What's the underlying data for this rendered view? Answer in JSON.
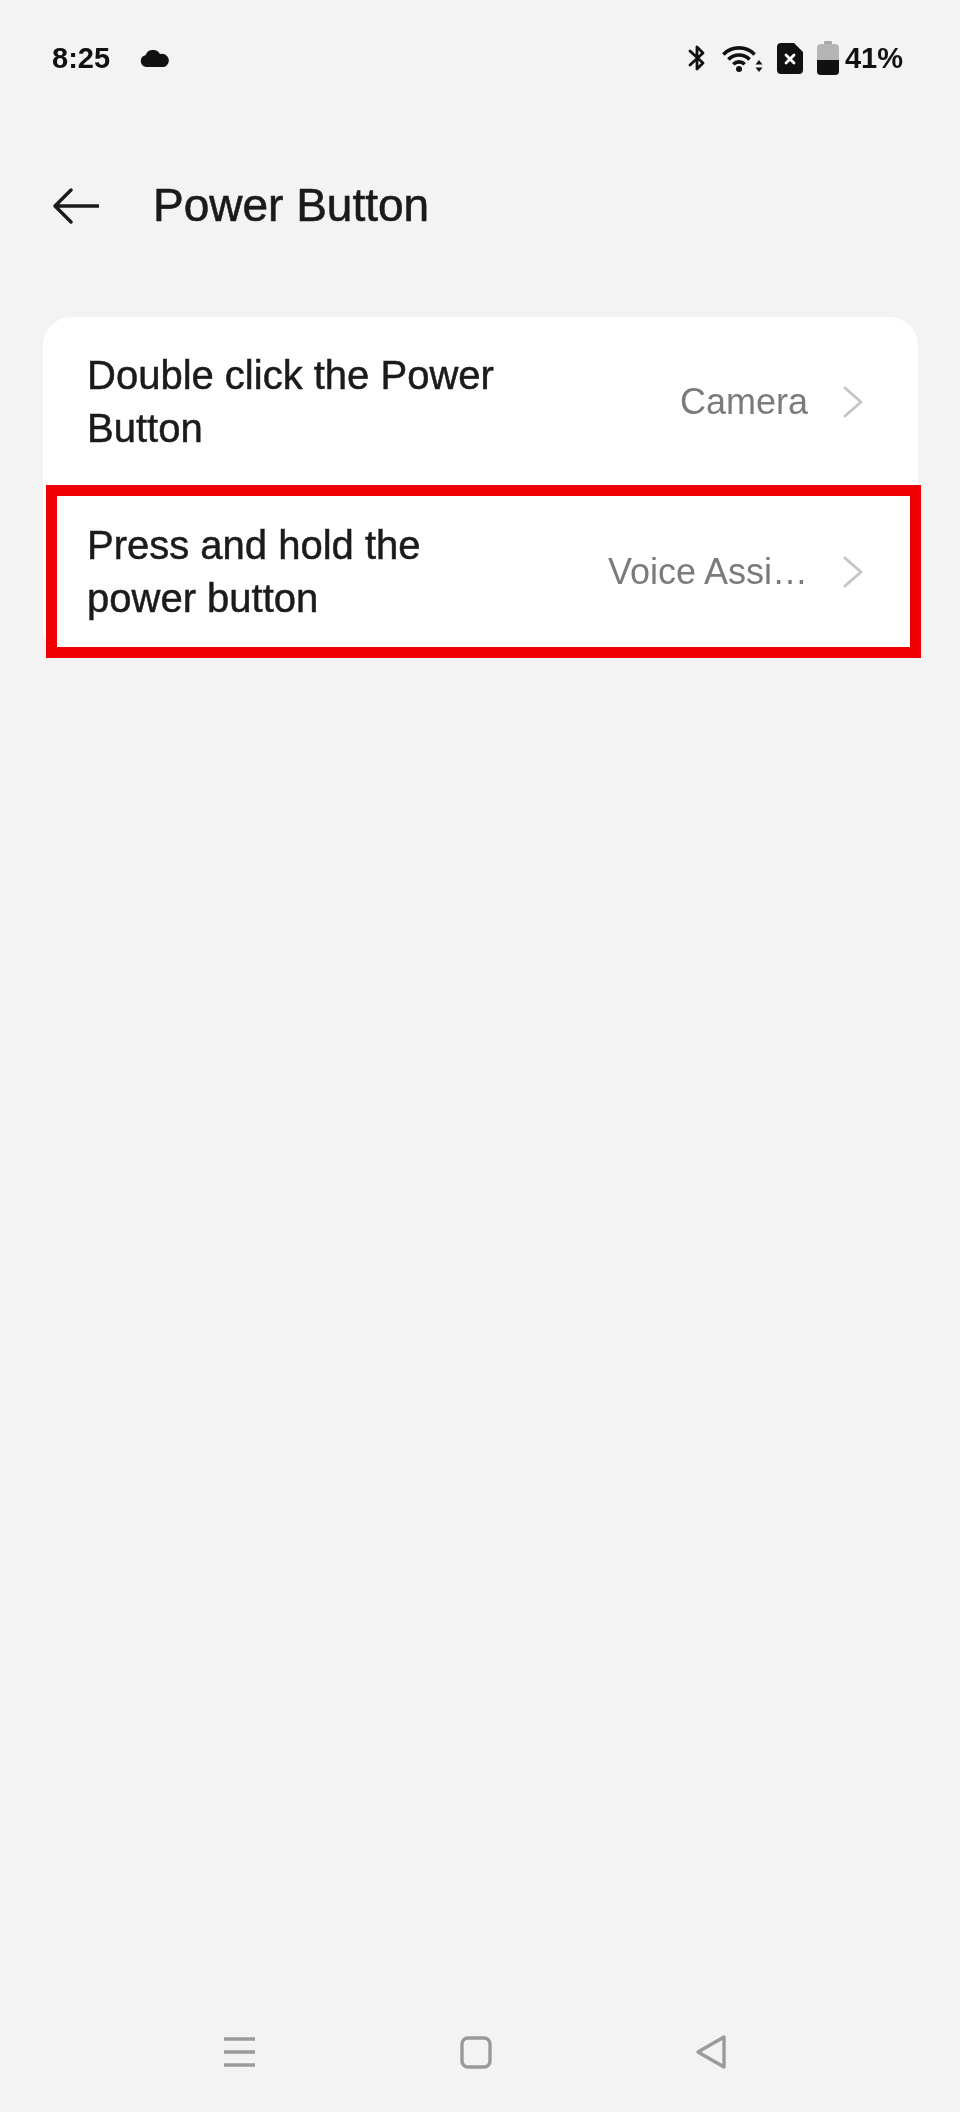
{
  "status_bar": {
    "time": "8:25",
    "battery": "41%"
  },
  "header": {
    "title": "Power Button"
  },
  "settings": [
    {
      "title": "Double click the Power Button",
      "value": "Camera",
      "highlighted": false
    },
    {
      "title": "Press and hold the power button",
      "value": "Voice Assi…",
      "highlighted": true
    }
  ]
}
